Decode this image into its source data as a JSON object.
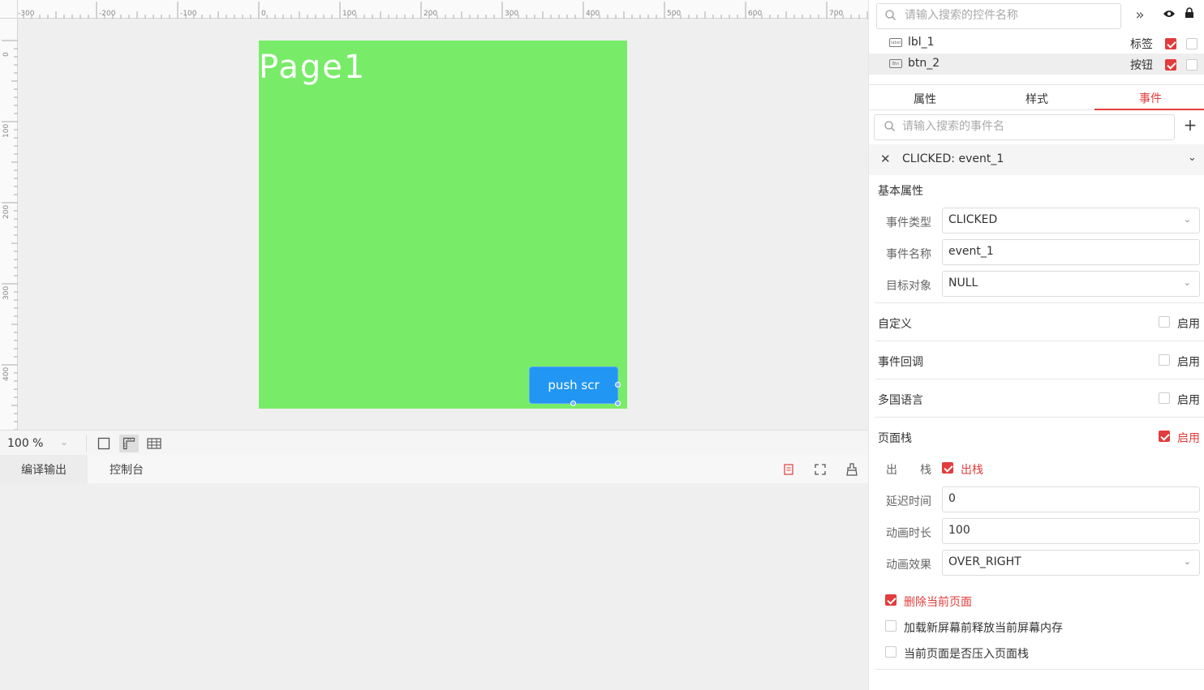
{
  "ruler": {
    "h_ticks": [
      "-300",
      "-200",
      "-100",
      "0",
      "100",
      "200",
      "300",
      "400",
      "500",
      "600",
      "700"
    ],
    "v_ticks": [
      "0",
      "100",
      "200",
      "300",
      "400"
    ]
  },
  "canvas": {
    "screen_bg": "#78ec68",
    "page_label": "Page1",
    "button_label": "push scr",
    "button_bg": "#2196f3"
  },
  "zoombar": {
    "zoom": "100 %"
  },
  "bottom": {
    "tabs": [
      "编译输出",
      "控制台"
    ]
  },
  "controls": {
    "search_placeholder": "请输入搜索的控件名称",
    "items": [
      {
        "name": "lbl_1",
        "type": "标签",
        "icon_text": "label",
        "visible": true,
        "locked": false,
        "selected": false
      },
      {
        "name": "btn_2",
        "type": "按钮",
        "icon_text": "Btn",
        "visible": true,
        "locked": false,
        "selected": true
      }
    ]
  },
  "tabs": [
    "属性",
    "样式",
    "事件"
  ],
  "active_tab": "事件",
  "events": {
    "search_placeholder": "请输入搜索的事件名",
    "header": "CLICKED: event_1",
    "basic_title": "基本属性",
    "fields": [
      {
        "label": "事件类型",
        "value": "CLICKED",
        "dropdown": true
      },
      {
        "label": "事件名称",
        "value": "event_1",
        "dropdown": false
      },
      {
        "label": "目标对象",
        "value": "NULL",
        "dropdown": true
      }
    ],
    "sections": [
      {
        "title": "自定义",
        "enabled": false
      },
      {
        "title": "事件回调",
        "enabled": false
      },
      {
        "title": "多国语言",
        "enabled": false
      },
      {
        "title": "页面栈",
        "enabled": true
      }
    ],
    "enable_label": "启用",
    "stack": {
      "pop_label": "出　　栈",
      "pop_option": "出栈",
      "pop_checked": true,
      "fields": [
        {
          "label": "延迟时间",
          "value": "0",
          "dropdown": false
        },
        {
          "label": "动画时长",
          "value": "100",
          "dropdown": false
        },
        {
          "label": "动画效果",
          "value": "OVER_RIGHT",
          "dropdown": true
        }
      ],
      "options": [
        {
          "label": "删除当前页面",
          "checked": true
        },
        {
          "label": "加载新屏幕前释放当前屏幕内存",
          "checked": false
        },
        {
          "label": "当前页面是否压入页面栈",
          "checked": false
        }
      ]
    }
  },
  "accent": "#e23c3c"
}
